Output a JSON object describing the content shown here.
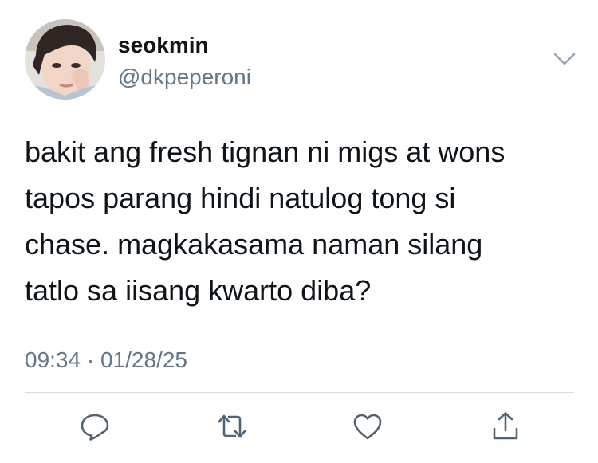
{
  "user": {
    "display_name": "seokmin",
    "handle": "@dkpeperoni",
    "avatar_icon": "profile-photo"
  },
  "tweet": {
    "text_lines": [
      "bakit ang fresh tignan ni migs at wons",
      "tapos parang hindi natulog tong si",
      "chase. magkakasama naman silang",
      "tatlo sa iisang kwarto diba?"
    ],
    "time": "09:34",
    "separator": "·",
    "date": "01/28/25"
  },
  "actions": [
    {
      "icon": "reply-icon"
    },
    {
      "icon": "retweet-icon"
    },
    {
      "icon": "like-icon"
    },
    {
      "icon": "share-icon"
    }
  ],
  "colors": {
    "text": "#0f1419",
    "secondary": "#657786",
    "icon": "#536471",
    "divider": "#d6dde3"
  }
}
